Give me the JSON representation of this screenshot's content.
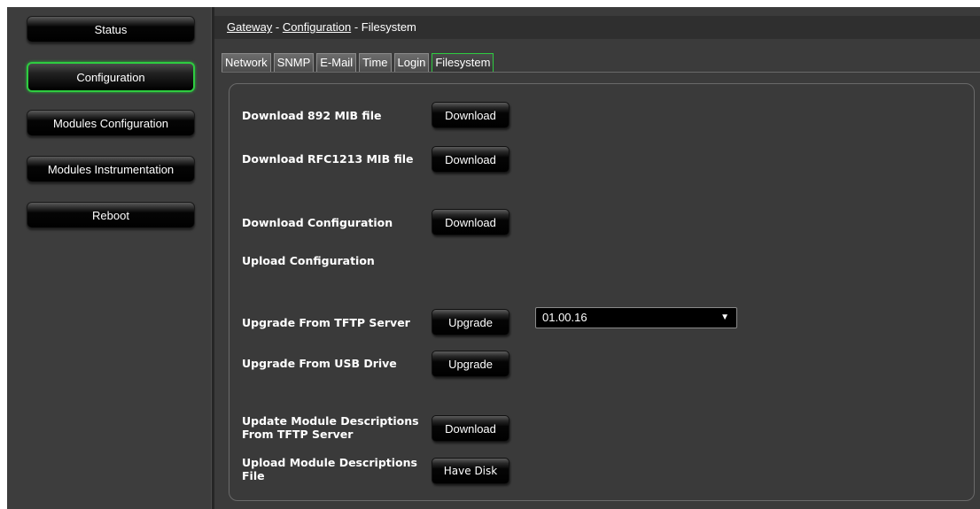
{
  "sidebar": {
    "items": [
      {
        "label": "Status"
      },
      {
        "label": "Configuration"
      },
      {
        "label": "Modules Configuration"
      },
      {
        "label": "Modules Instrumentation"
      },
      {
        "label": "Reboot"
      }
    ]
  },
  "breadcrumb": {
    "gateway": "Gateway",
    "sep1": " - ",
    "configuration": "Configuration",
    "sep2": " - ",
    "current": "Filesystem"
  },
  "tabs": [
    {
      "label": "Network"
    },
    {
      "label": "SNMP"
    },
    {
      "label": "E-Mail"
    },
    {
      "label": "Time"
    },
    {
      "label": "Login"
    },
    {
      "label": "Filesystem"
    }
  ],
  "filesystem": {
    "mib892": {
      "label": "Download 892 MIB file",
      "button": "Download"
    },
    "mibrfc": {
      "label": "Download RFC1213 MIB file",
      "button": "Download"
    },
    "config_download": {
      "label": "Download Configuration",
      "button": "Download"
    },
    "config_upload": {
      "label": "Upload Configuration"
    },
    "tftp_upgrade": {
      "label": "Upgrade From TFTP Server",
      "button": "Upgrade",
      "version": "01.00.16"
    },
    "usb_upgrade": {
      "label": "Upgrade From USB Drive",
      "button": "Upgrade"
    },
    "module_desc_update": {
      "label_line1": "Update Module Descriptions",
      "label_line2": "From TFTP Server",
      "button": "Download"
    },
    "module_desc_upload": {
      "label_line1": "Upload Module Descriptions",
      "label_line2": "File",
      "button": "Have Disk"
    }
  },
  "colors": {
    "active_border": "#2ecc40",
    "background": "#3a3a3a",
    "button_bg": "#000000"
  }
}
